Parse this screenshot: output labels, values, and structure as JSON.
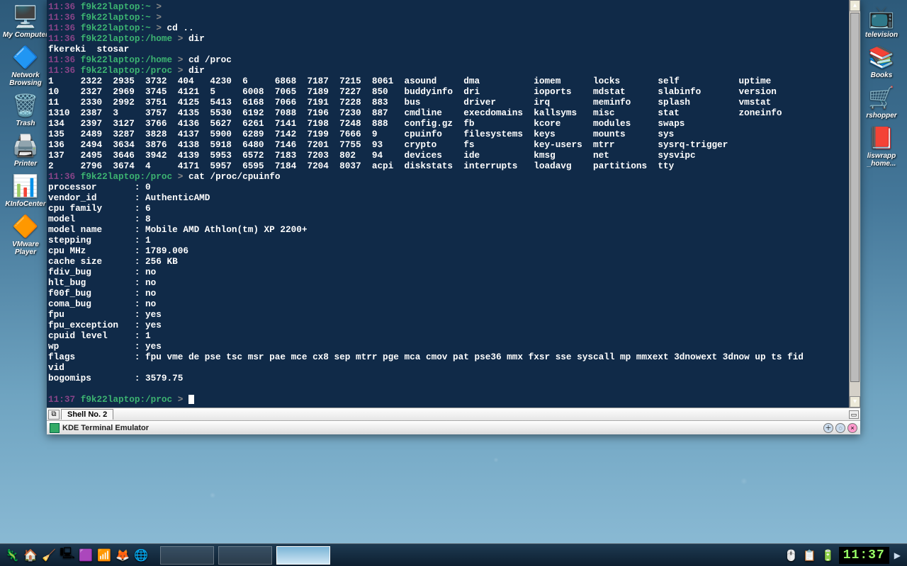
{
  "desktop": {
    "left": [
      {
        "label": "My Computer",
        "glyph": "🖥️"
      },
      {
        "label": "Network Browsing",
        "glyph": "🔷"
      },
      {
        "label": "Trash",
        "glyph": "🗑️"
      },
      {
        "label": "Printer",
        "glyph": "🖨️"
      },
      {
        "label": "KInfoCenter",
        "glyph": "📊"
      },
      {
        "label": "VMware Player",
        "glyph": "🔶"
      }
    ],
    "right": [
      {
        "label": "television",
        "glyph": "📺"
      },
      {
        "label": "Books",
        "glyph": "📚"
      },
      {
        "label": "rshopper",
        "glyph": "🛒"
      },
      {
        "label": "liswrapp _home...",
        "glyph": "📕"
      }
    ]
  },
  "terminal": {
    "tab_label": "Shell No. 2",
    "title": "KDE Terminal Emulator",
    "prompts": [
      {
        "ts": "11:36",
        "host": "f9k22laptop:~",
        "cmd": ""
      },
      {
        "ts": "11:36",
        "host": "f9k22laptop:~",
        "cmd": ""
      },
      {
        "ts": "11:36",
        "host": "f9k22laptop:~",
        "cmd": "cd .."
      },
      {
        "ts": "11:36",
        "host": "f9k22laptop:/home",
        "cmd": "dir"
      }
    ],
    "home_dir_out": "fkereki  stosar",
    "prompt_cdproc": {
      "ts": "11:36",
      "host": "f9k22laptop:/home",
      "cmd": "cd /proc"
    },
    "prompt_dirproc": {
      "ts": "11:36",
      "host": "f9k22laptop:/proc",
      "cmd": "dir"
    },
    "proc_listing": [
      "1     2322  2935  3732  404   4230  6     6868  7187  7215  8061  asound     dma          iomem      locks       self           uptime",
      "10    2327  2969  3745  4121  5     6008  7065  7189  7227  850   buddyinfo  dri          ioports    mdstat      slabinfo       version",
      "11    2330  2992  3751  4125  5413  6168  7066  7191  7228  883   bus        driver       irq        meminfo     splash         vmstat",
      "1310  2387  3     3757  4135  5530  6192  7088  7196  7230  887   cmdline    execdomains  kallsyms   misc        stat           zoneinfo",
      "134   2397  3127  3766  4136  5627  6261  7141  7198  7248  888   config.gz  fb           kcore      modules     swaps",
      "135   2489  3287  3828  4137  5900  6289  7142  7199  7666  9     cpuinfo    filesystems  keys       mounts      sys",
      "136   2494  3634  3876  4138  5918  6480  7146  7201  7755  93    crypto     fs           key-users  mtrr        sysrq-trigger",
      "137   2495  3646  3942  4139  5953  6572  7183  7203  802   94    devices    ide          kmsg       net         sysvipc",
      "2     2796  3674  4     4171  5957  6595  7184  7204  8037  acpi  diskstats  interrupts   loadavg    partitions  tty"
    ],
    "prompt_cat": {
      "ts": "11:36",
      "host": "f9k22laptop:/proc",
      "cmd": "cat /proc/cpuinfo"
    },
    "cpuinfo": [
      "processor       : 0",
      "vendor_id       : AuthenticAMD",
      "cpu family      : 6",
      "model           : 8",
      "model name      : Mobile AMD Athlon(tm) XP 2200+",
      "stepping        : 1",
      "cpu MHz         : 1789.006",
      "cache size      : 256 KB",
      "fdiv_bug        : no",
      "hlt_bug         : no",
      "f00f_bug        : no",
      "coma_bug        : no",
      "fpu             : yes",
      "fpu_exception   : yes",
      "cpuid level     : 1",
      "wp              : yes",
      "flags           : fpu vme de pse tsc msr pae mce cx8 sep mtrr pge mca cmov pat pse36 mmx fxsr sse syscall mp mmxext 3dnowext 3dnow up ts fid",
      "vid",
      "bogomips        : 3579.75"
    ],
    "final_prompt": {
      "ts": "11:37",
      "host": "f9k22laptop:/proc"
    }
  },
  "taskbar": {
    "quicklaunch": [
      {
        "name": "start",
        "glyph": "🦎"
      },
      {
        "name": "home",
        "glyph": "🏠"
      },
      {
        "name": "broom",
        "glyph": "🧹"
      },
      {
        "name": "terminal",
        "glyph": "🖳"
      },
      {
        "name": "kontact",
        "glyph": "🟪"
      },
      {
        "name": "network",
        "glyph": "📶"
      },
      {
        "name": "firefox",
        "glyph": "🦊"
      },
      {
        "name": "globe",
        "glyph": "🌐"
      }
    ],
    "tray": [
      {
        "name": "mouse",
        "glyph": "🖱️"
      },
      {
        "name": "clipboard",
        "glyph": "📋"
      },
      {
        "name": "power",
        "glyph": "🔋"
      }
    ],
    "clock": "11:37"
  }
}
